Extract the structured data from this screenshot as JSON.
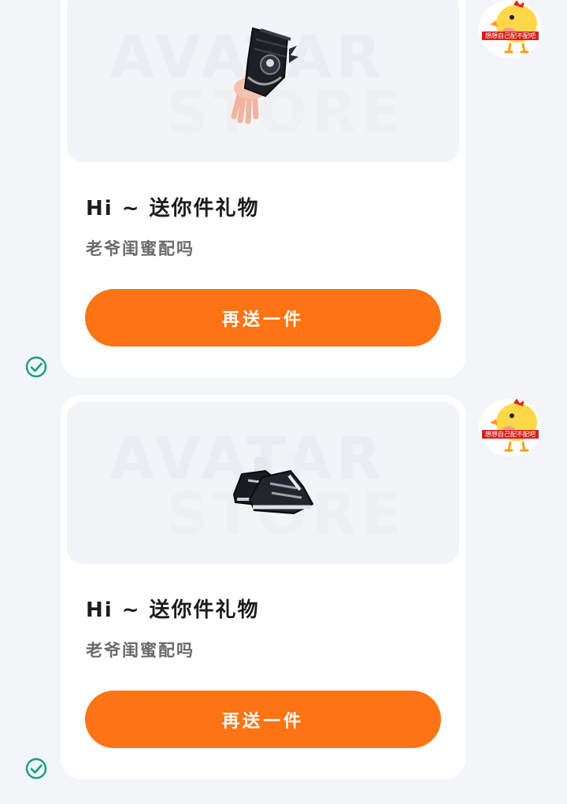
{
  "messages": [
    {
      "preview": {
        "item_icon": "glove-icon",
        "watermark_line1": "AVATAR",
        "watermark_line2": "STORE"
      },
      "title": "Hi ~ 送你件礼物",
      "subtitle": "老爷闺蜜配吗",
      "send_button": "再送一件",
      "avatar_caption": "想想自己配不配吧",
      "status_icon": "check-circle-icon"
    },
    {
      "preview": {
        "item_icon": "sneakers-icon",
        "watermark_line1": "AVATAR",
        "watermark_line2": "STORE"
      },
      "title": "Hi ~ 送你件礼物",
      "subtitle": "老爷闺蜜配吗",
      "send_button": "再送一件",
      "avatar_caption": "想想自己配不配吧",
      "status_icon": "check-circle-icon"
    }
  ],
  "colors": {
    "background": "#f4f5f9",
    "card": "#ffffff",
    "accent_button": "#fd7414",
    "status_check": "#16a07a"
  }
}
